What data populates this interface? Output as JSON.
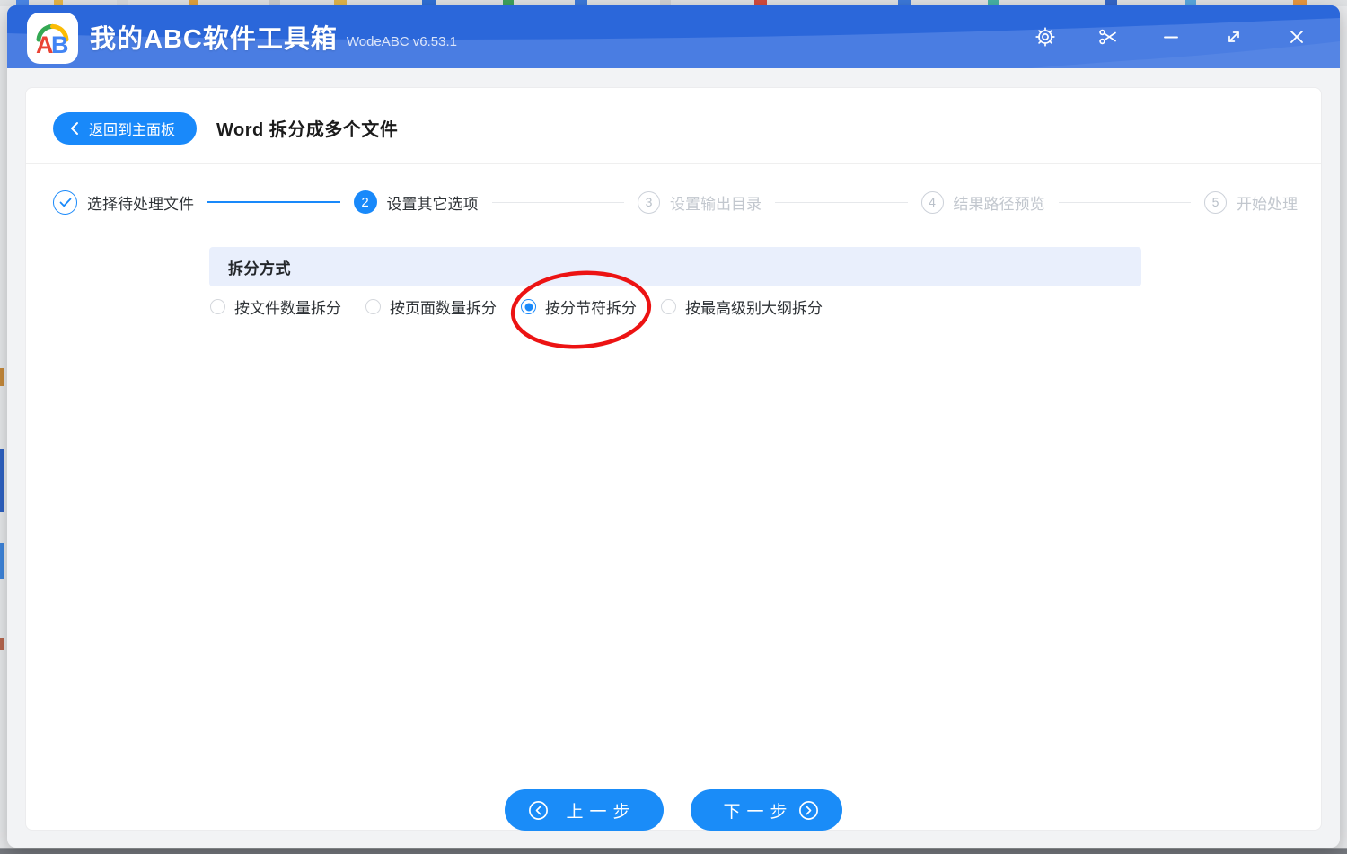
{
  "app": {
    "name": "我的ABC软件工具箱",
    "version": "WodeABC v6.53.1",
    "logo_text": "AB"
  },
  "titlebar_icons": [
    "gear",
    "scissors",
    "minimize",
    "maximize",
    "close"
  ],
  "page": {
    "back_button": "返回到主面板",
    "title": "Word 拆分成多个文件"
  },
  "steps": [
    {
      "num": "1",
      "label": "选择待处理文件",
      "state": "done"
    },
    {
      "num": "2",
      "label": "设置其它选项",
      "state": "active"
    },
    {
      "num": "3",
      "label": "设置输出目录",
      "state": "pending"
    },
    {
      "num": "4",
      "label": "结果路径预览",
      "state": "pending"
    },
    {
      "num": "5",
      "label": "开始处理",
      "state": "pending"
    }
  ],
  "split_options": {
    "header": "拆分方式",
    "radios": [
      {
        "label": "按文件数量拆分",
        "checked": false
      },
      {
        "label": "按页面数量拆分",
        "checked": false
      },
      {
        "label": "按分节符拆分",
        "checked": true,
        "annotation": "red-ellipse"
      },
      {
        "label": "按最高级别大纲拆分",
        "checked": false
      }
    ]
  },
  "footer": {
    "prev_button": "上一步",
    "next_button": "下一步"
  },
  "colors": {
    "accent": "#1989fa",
    "titlebar_top": "#2b67da",
    "titlebar_bottom": "#4a7de2",
    "section_header_bg": "#e9effc",
    "annotation_red": "#ec1313",
    "inactive_gray": "#c2c7ce"
  }
}
